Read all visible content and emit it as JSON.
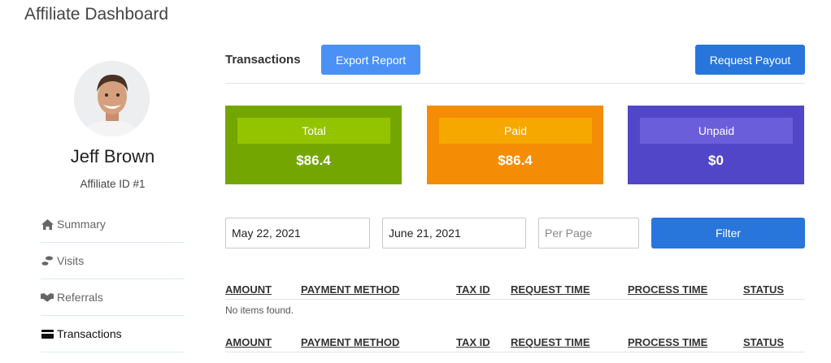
{
  "page": {
    "title": "Affiliate Dashboard"
  },
  "profile": {
    "name": "Jeff Brown",
    "affiliate_id": "Affiliate ID #1"
  },
  "nav": {
    "items": [
      {
        "label": "Summary",
        "icon": "home-icon",
        "active": false
      },
      {
        "label": "Visits",
        "icon": "footsteps-icon",
        "active": false
      },
      {
        "label": "Referrals",
        "icon": "handshake-icon",
        "active": false
      },
      {
        "label": "Transactions",
        "icon": "credit-card-icon",
        "active": true
      }
    ]
  },
  "transactions": {
    "title": "Transactions",
    "export_label": "Export Report",
    "payout_label": "Request Payout"
  },
  "cards": {
    "total": {
      "label": "Total",
      "value": "$86.4",
      "color": "#73a600",
      "label_color": "#94c300"
    },
    "paid": {
      "label": "Paid",
      "value": "$86.4",
      "color": "#f48c05",
      "label_color": "#f6a800"
    },
    "unpaid": {
      "label": "Unpaid",
      "value": "$0",
      "color": "#5246c8",
      "label_color": "#6b5edb"
    }
  },
  "filters": {
    "start_date": "May 22, 2021",
    "end_date": "June 21, 2021",
    "per_page_placeholder": "Per Page",
    "filter_label": "Filter"
  },
  "table": {
    "columns": [
      "AMOUNT",
      "PAYMENT METHOD",
      "TAX ID",
      "REQUEST TIME",
      "PROCESS TIME",
      "STATUS"
    ],
    "rows": [],
    "empty_text": "No items found."
  },
  "colors": {
    "primary": "#2876dc",
    "export": "#4a90f5"
  }
}
